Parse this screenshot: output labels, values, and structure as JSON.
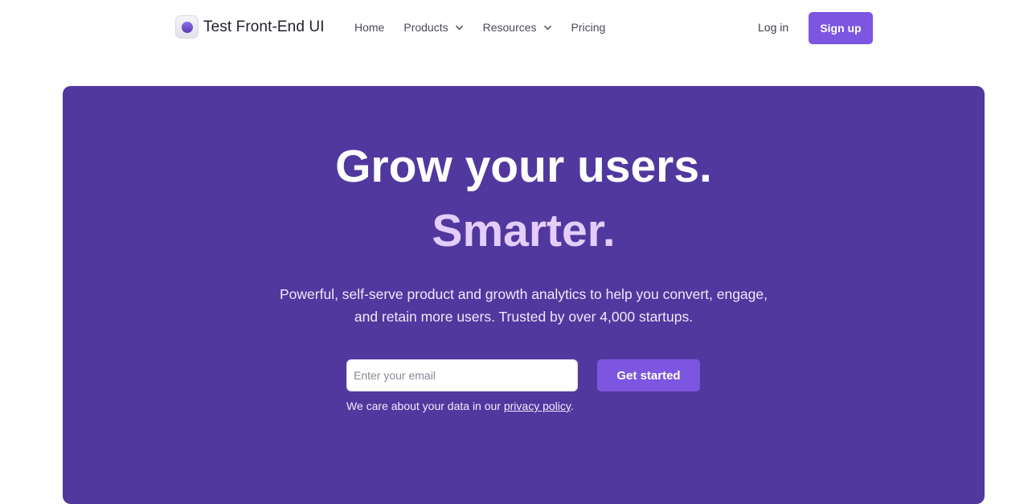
{
  "brand": {
    "name": "Test Front-End UI",
    "logo_icon": "logo-orb-icon",
    "accent_color": "#7c55e0",
    "hero_background": "#51389e"
  },
  "nav": {
    "items": [
      {
        "label": "Home",
        "has_dropdown": false
      },
      {
        "label": "Products",
        "has_dropdown": true
      },
      {
        "label": "Resources",
        "has_dropdown": true
      },
      {
        "label": "Pricing",
        "has_dropdown": false
      }
    ],
    "dropdown_icon": "chevron-down-icon"
  },
  "auth": {
    "login_label": "Log in",
    "signup_label": "Sign up"
  },
  "hero": {
    "headline_line1": "Grow your users.",
    "headline_line2": "Smarter.",
    "subheading_line1": "Powerful, self-serve product and growth analytics to help you convert, engage,",
    "subheading_line2": "and retain more users. Trusted by over 4,000 startups.",
    "email_placeholder": "Enter your email",
    "email_value": "",
    "cta_label": "Get started",
    "privacy_prefix": "We care about your data in our ",
    "privacy_link": "privacy policy",
    "privacy_suffix": "."
  }
}
